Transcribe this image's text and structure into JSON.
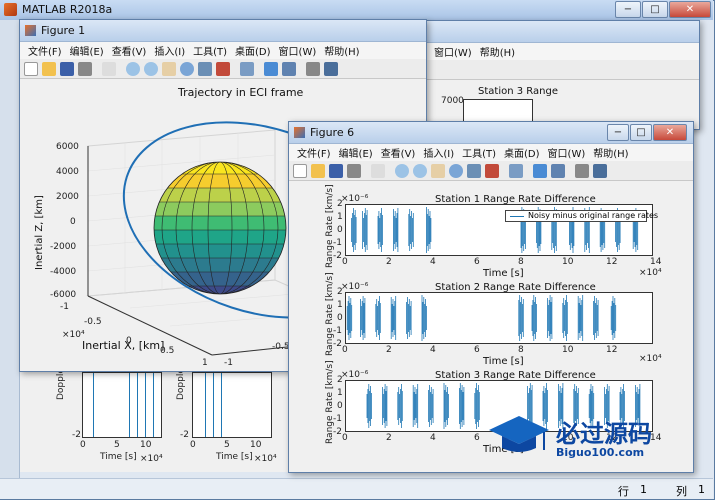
{
  "app": {
    "title": "MATLAB R2018a"
  },
  "window_buttons": {
    "min": "−",
    "max": "□",
    "close": "✕"
  },
  "figure1": {
    "title": "Figure 1",
    "menu": [
      "文件(F)",
      "编辑(E)",
      "查看(V)",
      "插入(I)",
      "工具(T)",
      "桌面(D)",
      "窗口(W)",
      "帮助(H)"
    ],
    "plot_title": "Trajectory in ECI frame",
    "zlabel": "Inertial Z, [km]",
    "xlabel": "Inertial X, [km]",
    "z_ticks": [
      "6000",
      "4000",
      "2000",
      "0",
      "-2000",
      "-4000",
      "-6000"
    ],
    "x_ticks": [
      "-1",
      "-0.5",
      "0",
      "0.5",
      "1"
    ],
    "x_exp": "×10⁴",
    "y_ticks": [
      "-1",
      "-0.5"
    ]
  },
  "figure_station3": {
    "title": "Station 3 Range",
    "y_tick": "7000",
    "menu": [
      "窗口(W)",
      "帮助(H)"
    ]
  },
  "figure6": {
    "title": "Figure 6",
    "menu": [
      "文件(F)",
      "编辑(E)",
      "查看(V)",
      "插入(I)",
      "工具(T)",
      "桌面(D)",
      "窗口(W)",
      "帮助(H)"
    ],
    "subplots": [
      {
        "title": "Station 1 Range Rate Difference",
        "ylabel": "Range Rate [km/s]",
        "xlabel": "Time [s]",
        "exp": "×10⁻⁶",
        "xexp": "×10⁴",
        "legend": "Noisy minus original range rates",
        "yticks": [
          "2",
          "1",
          "0",
          "-1",
          "-2"
        ],
        "xticks": [
          "0",
          "2",
          "4",
          "6",
          "8",
          "10",
          "12",
          "14"
        ],
        "bursts": [
          0.3,
          0.8,
          1.5,
          2.2,
          2.9,
          3.7,
          8.0,
          8.7,
          9.4,
          10.2,
          10.9,
          11.6,
          12.3,
          13.1
        ]
      },
      {
        "title": "Station 2 Range Rate Difference",
        "ylabel": "Range Rate [km/s]",
        "xlabel": "Time [s]",
        "exp": "×10⁻⁶",
        "xexp": "×10⁴",
        "yticks": [
          "2",
          "1",
          "0",
          "-1",
          "-2"
        ],
        "xticks": [
          "0",
          "2",
          "4",
          "6",
          "8",
          "10",
          "12"
        ],
        "bursts": [
          0.1,
          0.7,
          1.4,
          2.1,
          2.8,
          3.5,
          7.9,
          8.5,
          9.2,
          9.9,
          10.6,
          11.3,
          12.1
        ]
      },
      {
        "title": "Station 3 Range Rate Difference",
        "ylabel": "Range Rate [km/s]",
        "xlabel": "Time [s]",
        "exp": "×10⁻⁶",
        "yticks": [
          "2",
          "1",
          "0",
          "-1",
          "-2"
        ],
        "xticks": [
          "0",
          "2",
          "4",
          "6",
          "8",
          "10",
          "12",
          "14"
        ],
        "bursts": [
          1.0,
          1.7,
          2.4,
          3.1,
          3.8,
          4.5,
          5.2,
          5.9,
          8.3,
          9.0,
          9.7,
          10.4,
          11.1,
          11.8,
          12.5,
          13.2
        ]
      }
    ]
  },
  "doppler": {
    "ylabel": "Doppler Shift",
    "xlabel": "Time [s]",
    "xexp": "×10⁴",
    "xticks": [
      "0",
      "5",
      "10"
    ],
    "ytick": "-2"
  },
  "status": {
    "line_label": "行",
    "line": "1",
    "col_label": "列",
    "col": "1"
  },
  "watermark": {
    "text": "必过源码",
    "sub": "Biguo100.com"
  }
}
